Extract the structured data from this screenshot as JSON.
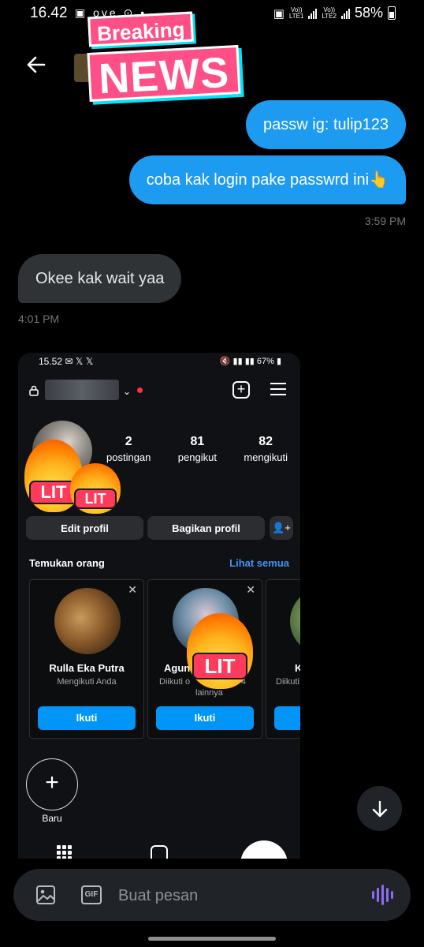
{
  "status_bar": {
    "time": "16.42",
    "left_icons": "▣ ove ⊙ •",
    "net1_top": "Vo))",
    "net1_bottom": "LTE1",
    "net2_top": "Vo))",
    "net2_bottom": "LTE2",
    "battery": "58%"
  },
  "header": {
    "sticker_small": "Breaking",
    "sticker_big": "NEWS"
  },
  "messages": {
    "outgoing_1": "passw ig: tulip123",
    "outgoing_2": "coba kak login pake passwrd ini👆",
    "outgoing_time": "3:59 PM",
    "incoming_1": "Okee kak wait yaa",
    "incoming_time": "4:01 PM"
  },
  "screenshot": {
    "status_time": "15.52",
    "status_left_icons": "✉ 𝕏 𝕏",
    "status_right": "67%",
    "stats": [
      {
        "value": "2",
        "label": "postingan"
      },
      {
        "value": "81",
        "label": "pengikut"
      },
      {
        "value": "82",
        "label": "mengikuti"
      }
    ],
    "lit_label": "LIT",
    "edit_profile": "Edit profil",
    "share_profile": "Bagikan profil",
    "discover_title": "Temukan orang",
    "see_all": "Lihat semua",
    "cards": [
      {
        "name": "Rulla Eka Putra",
        "subtitle": "Mengikuti Anda",
        "follow": "Ikuti"
      },
      {
        "name": "Agun",
        "subtitle": "Diikuti o",
        "subtitle_tail": "4",
        "subtitle_line2": "lainnya",
        "follow": "Ikuti"
      },
      {
        "name": "K",
        "subtitle": "Diikuti"
      }
    ],
    "new_label": "Baru"
  },
  "composer": {
    "placeholder": "Buat pesan",
    "gif_label": "GIF"
  },
  "colors": {
    "outgoing_bubble": "#1d9bf0",
    "incoming_bubble": "#2f3336",
    "follow_button": "#0095f6",
    "voice_icon": "#8d6cf5"
  }
}
